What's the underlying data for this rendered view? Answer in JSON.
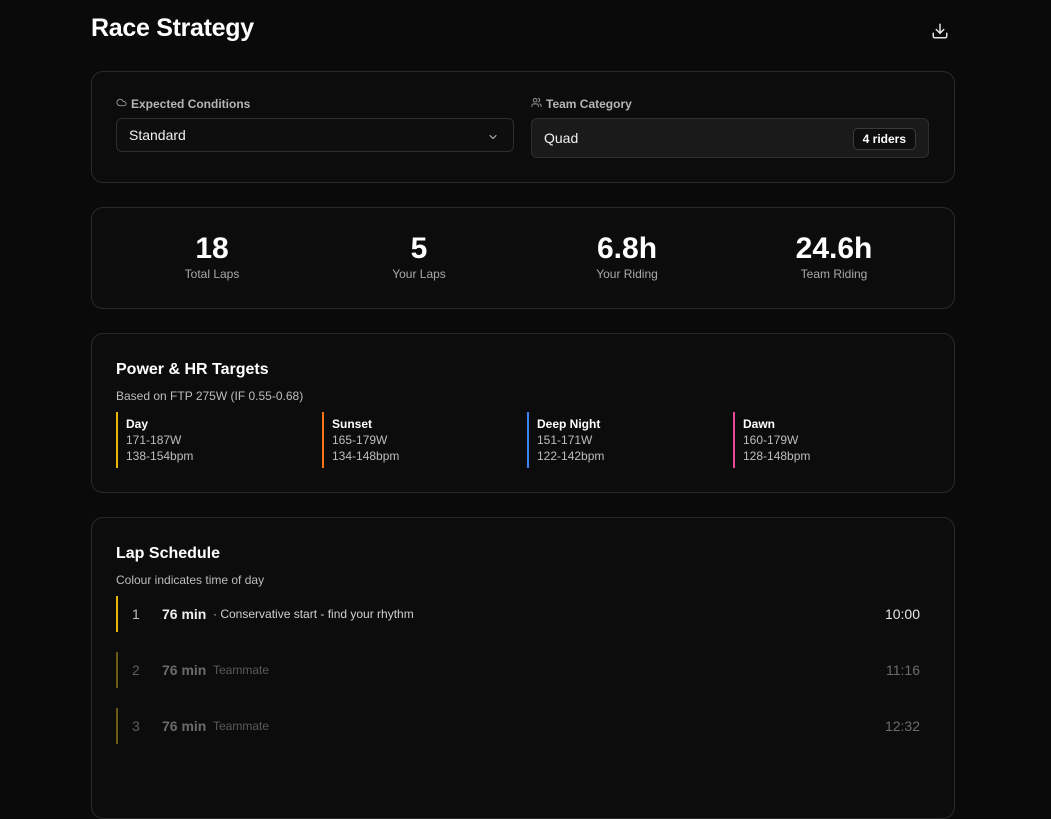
{
  "page": {
    "title": "Race Strategy",
    "download_icon": "download-icon"
  },
  "conditions": {
    "label": "Expected Conditions",
    "value": "Standard",
    "icon": "cloud-icon"
  },
  "team": {
    "label": "Team Category",
    "value": "Quad",
    "badge": "4 riders",
    "icon": "users-icon"
  },
  "stats": [
    {
      "value": "18",
      "label": "Total Laps"
    },
    {
      "value": "5",
      "label": "Your Laps"
    },
    {
      "value": "6.8h",
      "label": "Your Riding"
    },
    {
      "value": "24.6h",
      "label": "Team Riding"
    }
  ],
  "targets": {
    "title": "Power & HR Targets",
    "subtitle": "Based on FTP 275W (IF 0.55-0.68)",
    "zones": [
      {
        "name": "Day",
        "power": "171-187W",
        "hr": "138-154bpm",
        "color": "#eab308"
      },
      {
        "name": "Sunset",
        "power": "165-179W",
        "hr": "134-148bpm",
        "color": "#f97316"
      },
      {
        "name": "Deep Night",
        "power": "151-171W",
        "hr": "122-142bpm",
        "color": "#3b82f6"
      },
      {
        "name": "Dawn",
        "power": "160-179W",
        "hr": "128-148bpm",
        "color": "#ec4899"
      }
    ]
  },
  "schedule": {
    "title": "Lap Schedule",
    "subtitle": "Colour indicates time of day",
    "laps": [
      {
        "num": "1",
        "duration": "76 min",
        "note": "· Conservative start - find your rhythm",
        "time": "10:00"
      },
      {
        "num": "2",
        "duration": "76 min",
        "note": "Teammate",
        "time": "11:16"
      },
      {
        "num": "3",
        "duration": "76 min",
        "note": "Teammate",
        "time": "12:32"
      }
    ]
  }
}
